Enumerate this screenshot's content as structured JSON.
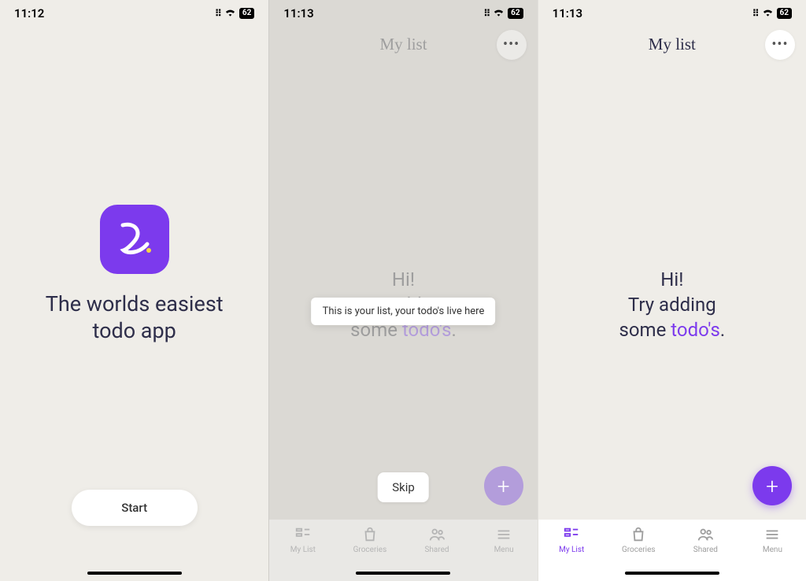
{
  "screens": {
    "s1": {
      "status_time": "11:12",
      "battery": "62",
      "tagline_line1": "The worlds easiest",
      "tagline_line2": "todo app",
      "start_label": "Start"
    },
    "s2": {
      "status_time": "11:13",
      "battery": "62",
      "header_title": "My list",
      "greet_hi": "Hi!",
      "greet_line2a": "Try adding",
      "greet_line3a": "some ",
      "greet_accent": "todo's",
      "greet_dot": ".",
      "tooltip_text": "This is your list, your todo's live here",
      "skip_label": "Skip"
    },
    "s3": {
      "status_time": "11:13",
      "battery": "62",
      "header_title": "My list",
      "greet_hi": "Hi!",
      "greet_line2a": "Try adding",
      "greet_line3a": "some ",
      "greet_accent": "todo's",
      "greet_dot": "."
    },
    "tabs": {
      "mylist": "My List",
      "groceries": "Groceries",
      "shared": "Shared",
      "menu": "Menu"
    }
  },
  "colors": {
    "purple": "#7c3aed"
  }
}
